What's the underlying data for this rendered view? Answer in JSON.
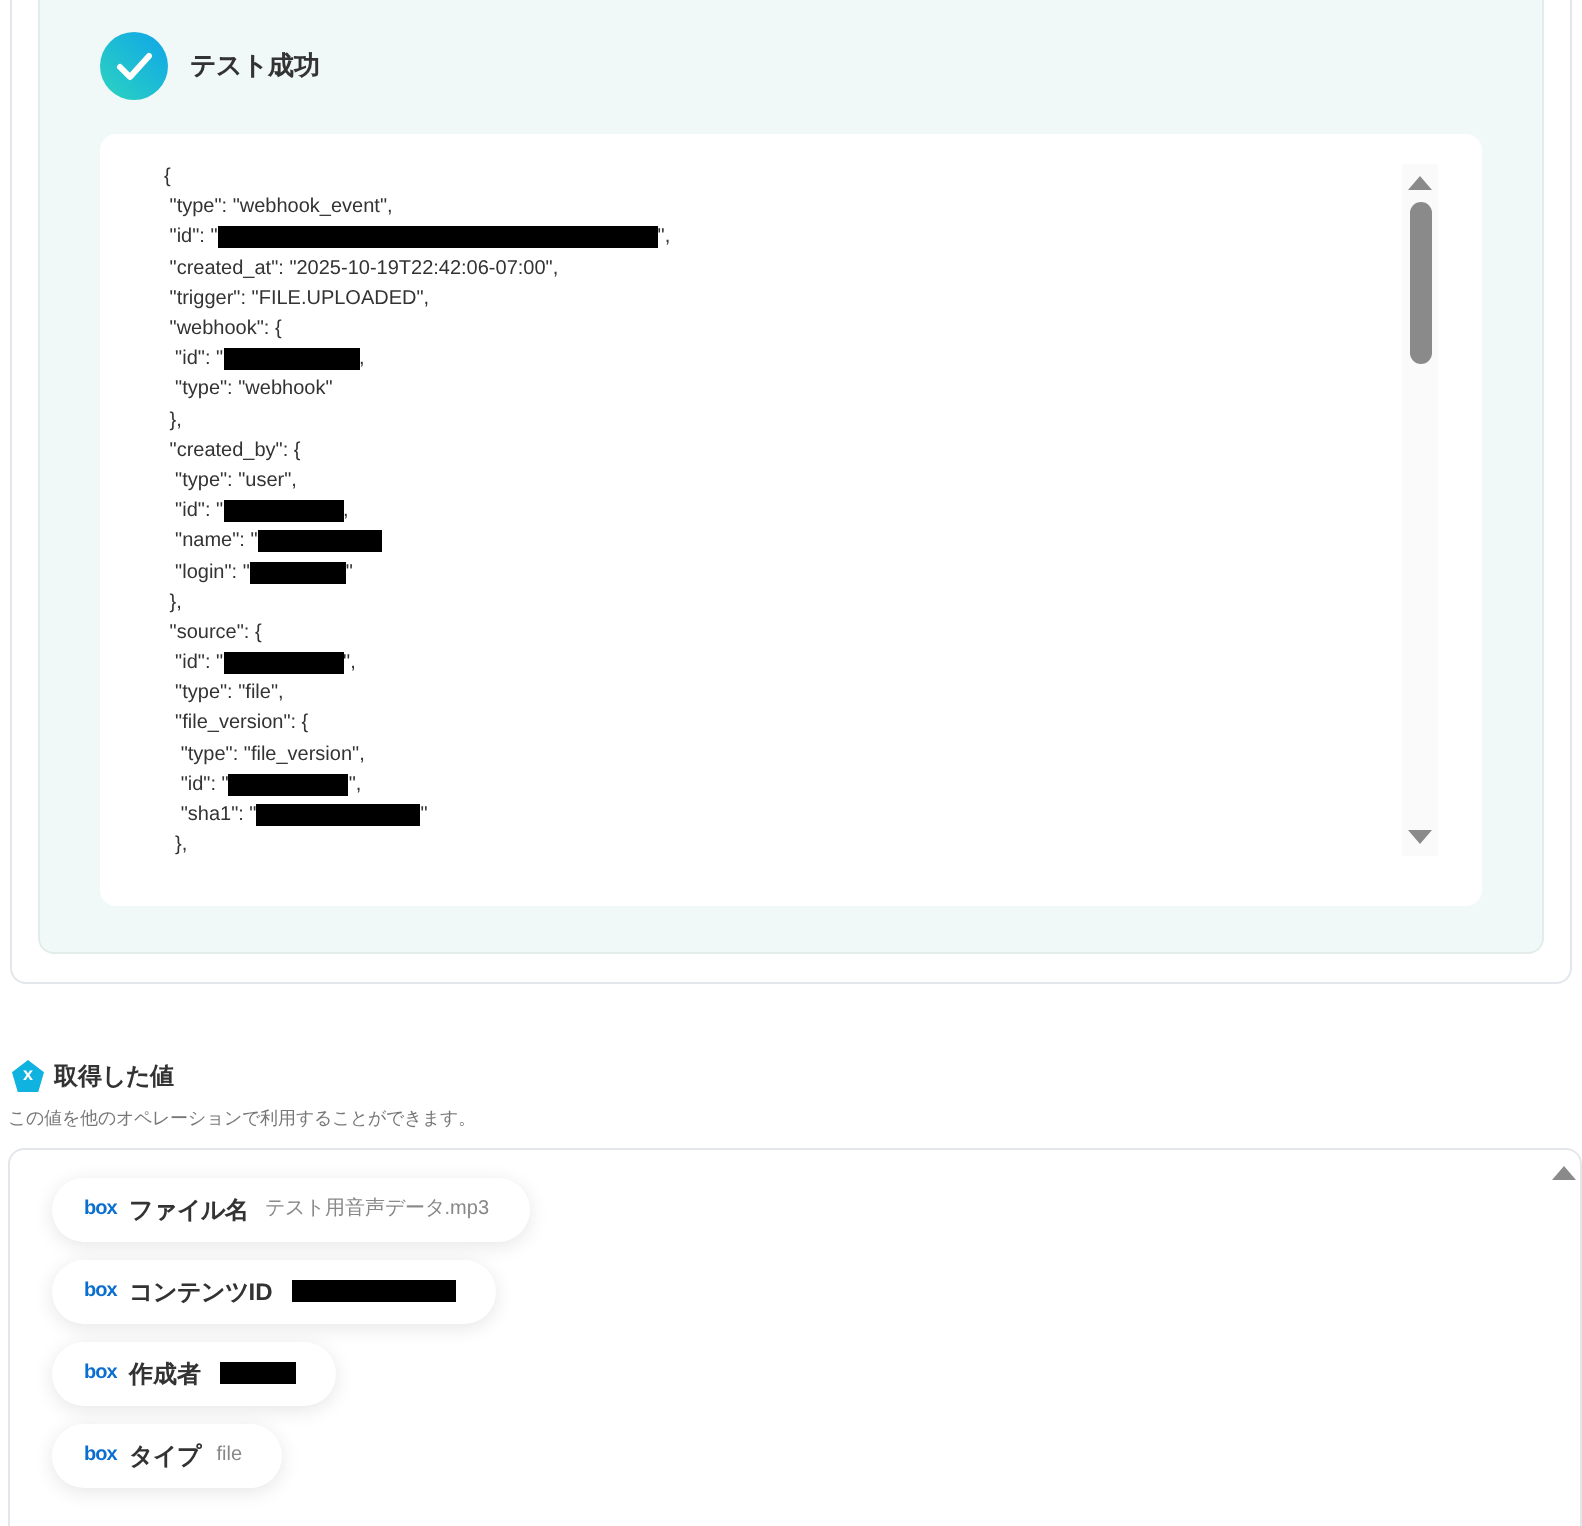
{
  "result": {
    "title": "テスト成功",
    "code_lines": [
      {
        "parts": [
          {
            "kind": "text",
            "text": "{"
          }
        ]
      },
      {
        "parts": [
          {
            "kind": "text",
            "text": " \"type\": \"webhook_event\","
          }
        ]
      },
      {
        "parts": [
          {
            "kind": "text",
            "text": " \"id\": \""
          },
          {
            "kind": "redacted"
          },
          {
            "kind": "text",
            "text": "\","
          }
        ]
      },
      {
        "parts": [
          {
            "kind": "text",
            "text": " \"created_at\": \"2025-10-19T22:42:06-07:00\","
          }
        ]
      },
      {
        "parts": [
          {
            "kind": "text",
            "text": " \"trigger\": \"FILE.UPLOADED\","
          }
        ]
      },
      {
        "parts": [
          {
            "kind": "text",
            "text": " \"webhook\": {"
          }
        ]
      },
      {
        "parts": [
          {
            "kind": "text",
            "text": "  \"id\": \""
          },
          {
            "kind": "redacted"
          },
          {
            "kind": "text",
            "text": ","
          }
        ]
      },
      {
        "parts": [
          {
            "kind": "text",
            "text": "  \"type\": \"webhook\""
          }
        ]
      },
      {
        "parts": [
          {
            "kind": "text",
            "text": " },"
          }
        ]
      },
      {
        "parts": [
          {
            "kind": "text",
            "text": " \"created_by\": {"
          }
        ]
      },
      {
        "parts": [
          {
            "kind": "text",
            "text": "  \"type\": \"user\","
          }
        ]
      },
      {
        "parts": [
          {
            "kind": "text",
            "text": "  \"id\": \""
          },
          {
            "kind": "redacted"
          },
          {
            "kind": "text",
            "text": ","
          }
        ]
      },
      {
        "parts": [
          {
            "kind": "text",
            "text": "  \"name\": \""
          },
          {
            "kind": "redacted"
          }
        ]
      },
      {
        "parts": [
          {
            "kind": "text",
            "text": "  \"login\": \""
          },
          {
            "kind": "redacted"
          },
          {
            "kind": "text",
            "text": "\""
          }
        ]
      },
      {
        "parts": [
          {
            "kind": "text",
            "text": " },"
          }
        ]
      },
      {
        "parts": [
          {
            "kind": "text",
            "text": " \"source\": {"
          }
        ]
      },
      {
        "parts": [
          {
            "kind": "text",
            "text": "  \"id\": \""
          },
          {
            "kind": "redacted"
          },
          {
            "kind": "text",
            "text": "\","
          }
        ]
      },
      {
        "parts": [
          {
            "kind": "text",
            "text": "  \"type\": \"file\","
          }
        ]
      },
      {
        "parts": [
          {
            "kind": "text",
            "text": "  \"file_version\": {"
          }
        ]
      },
      {
        "parts": [
          {
            "kind": "text",
            "text": "   \"type\": \"file_version\","
          }
        ]
      },
      {
        "parts": [
          {
            "kind": "text",
            "text": "   \"id\": \""
          },
          {
            "kind": "redacted"
          },
          {
            "kind": "text",
            "text": "\","
          }
        ]
      },
      {
        "parts": [
          {
            "kind": "text",
            "text": "   \"sha1\": \""
          },
          {
            "kind": "redacted"
          },
          {
            "kind": "text",
            "text": "\""
          }
        ]
      },
      {
        "parts": [
          {
            "kind": "text",
            "text": "  },"
          }
        ]
      }
    ]
  },
  "values": {
    "title": "取得した値",
    "badge": "x",
    "description": "この値を他のオペレーションで利用することができます。",
    "items": [
      {
        "logo": "box",
        "label": "ファイル名",
        "kind": "text",
        "value": "テスト用音声データ.mp3"
      },
      {
        "logo": "box",
        "label": "コンテンツID",
        "kind": "redacted"
      },
      {
        "logo": "box",
        "label": "作成者",
        "kind": "redacted"
      },
      {
        "logo": "box",
        "label": "タイプ",
        "kind": "text",
        "value": "file"
      }
    ]
  }
}
